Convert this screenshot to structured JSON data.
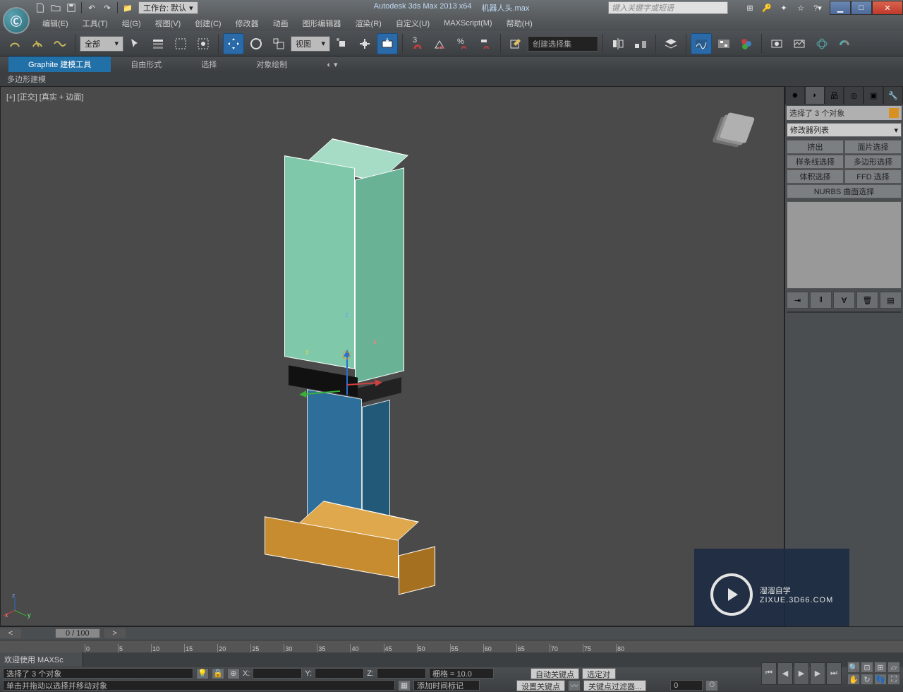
{
  "title": {
    "app": "Autodesk 3ds Max  2013 x64",
    "file": "机器人头.max"
  },
  "workspace": {
    "label": "工作台: 默认"
  },
  "search": {
    "placeholder": "键入关键字或短语"
  },
  "menus": [
    "编辑(E)",
    "工具(T)",
    "组(G)",
    "视图(V)",
    "创建(C)",
    "修改器",
    "动画",
    "图形编辑器",
    "渲染(R)",
    "自定义(U)",
    "MAXScript(M)",
    "帮助(H)"
  ],
  "toolbar": {
    "filter_all": "全部",
    "view_dd": "视图",
    "selset": "创建选择集"
  },
  "ribbon": {
    "tabs": [
      "Graphite 建模工具",
      "自由形式",
      "选择",
      "对象绘制"
    ],
    "sub": "多边形建模"
  },
  "viewport": {
    "label": "[+] [正交] [真实 + 边面]",
    "gizmo": {
      "x": "x",
      "y": "y",
      "z": "z"
    }
  },
  "cmdpanel": {
    "selection": "选择了 3 个对象",
    "modlist": "修改器列表",
    "buttons": [
      "挤出",
      "面片选择",
      "样条线选择",
      "多边形选择",
      "体积选择",
      "FFD 选择",
      "NURBS 曲面选择"
    ]
  },
  "timeline": {
    "slider": "0 / 100",
    "ticks": [
      0,
      5,
      10,
      15,
      20,
      25,
      30,
      35,
      40,
      45,
      50,
      55,
      60,
      65,
      70,
      75,
      80
    ],
    "track_label": "欢迎使用  MAXSc"
  },
  "status": {
    "sel": "选择了 3 个对象",
    "hint": "单击并拖动以选择并移动对象",
    "x": "X:",
    "y": "Y:",
    "z": "Z:",
    "grid": "栅格 = 10.0",
    "addtime": "添加时间标记",
    "autokey": "自动关键点",
    "setkey": "设置关键点",
    "seldef": "选定对",
    "keyfilter": "关键点过滤器..."
  },
  "watermark": {
    "text": "溜溜自学",
    "sub": "ZIXUE.3D66.COM"
  }
}
